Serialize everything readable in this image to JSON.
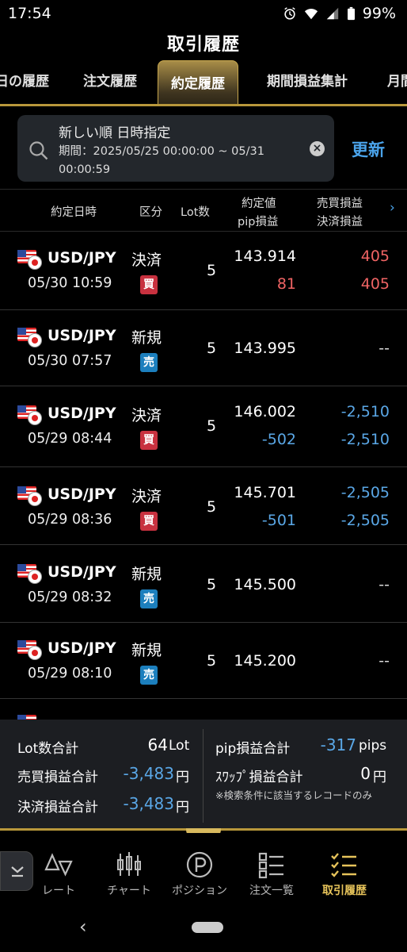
{
  "status_bar": {
    "time": "17:54",
    "battery": "99%",
    "icons": [
      "alarm-icon",
      "wifi-icon",
      "signal-icon",
      "battery-icon"
    ]
  },
  "header": {
    "title": "取引履歴"
  },
  "tabs": [
    {
      "label": "日の履歴"
    },
    {
      "label": "注文履歴"
    },
    {
      "label": "約定履歴",
      "active": true
    },
    {
      "label": "期間損益集計"
    },
    {
      "label": "月間"
    }
  ],
  "search": {
    "line1": "新しい順 日時指定",
    "line2": "期間：2025/05/25 00:00:00 ~ 05/31 00:00:59",
    "clear_icon": "×"
  },
  "refresh_label": "更新",
  "table_header": {
    "datetime": "約定日時",
    "kind": "区分",
    "lot": "Lot数",
    "price": "約定値",
    "pip": "pip損益",
    "trade_pl": "売買損益",
    "settle_pl": "決済損益",
    "more": "›"
  },
  "rows": [
    {
      "pair": "USD/JPY",
      "datetime": "05/30 10:59",
      "kind": "決済",
      "side": "買",
      "lot": "5",
      "price": "143.914",
      "pip": "81",
      "trade_pl": "405",
      "settle_pl": "405"
    },
    {
      "pair": "USD/JPY",
      "datetime": "05/30 07:57",
      "kind": "新規",
      "side": "売",
      "lot": "5",
      "price": "143.995",
      "pip": "",
      "trade_pl": "--",
      "settle_pl": ""
    },
    {
      "pair": "USD/JPY",
      "datetime": "05/29 08:44",
      "kind": "決済",
      "side": "買",
      "lot": "5",
      "price": "146.002",
      "pip": "-502",
      "trade_pl": "-2,510",
      "settle_pl": "-2,510"
    },
    {
      "pair": "USD/JPY",
      "datetime": "05/29 08:36",
      "kind": "決済",
      "side": "買",
      "lot": "5",
      "price": "145.701",
      "pip": "-501",
      "trade_pl": "-2,505",
      "settle_pl": "-2,505"
    },
    {
      "pair": "USD/JPY",
      "datetime": "05/29 08:32",
      "kind": "新規",
      "side": "売",
      "lot": "5",
      "price": "145.500",
      "pip": "",
      "trade_pl": "--",
      "settle_pl": ""
    },
    {
      "pair": "USD/JPY",
      "datetime": "05/29 08:10",
      "kind": "新規",
      "side": "売",
      "lot": "5",
      "price": "145.200",
      "pip": "",
      "trade_pl": "--",
      "settle_pl": ""
    }
  ],
  "summary": {
    "lot_label": "Lot数合計",
    "lot_value": "64",
    "lot_unit": "Lot",
    "trade_label": "売買損益合計",
    "trade_value": "-3,483",
    "trade_unit": "円",
    "settle_label": "決済損益合計",
    "settle_value": "-3,483",
    "settle_unit": "円",
    "pip_label": "pip損益合計",
    "pip_value": "-317",
    "pip_unit": "pips",
    "swap_label": "ｽﾜｯﾌﾟ損益合計",
    "swap_value": "0",
    "swap_unit": "円",
    "note": "※検索条件に該当するレコードのみ"
  },
  "bottom_nav": [
    {
      "label": "レート",
      "icon": "rate-icon"
    },
    {
      "label": "チャート",
      "icon": "chart-icon"
    },
    {
      "label": "ポジション",
      "icon": "position-icon"
    },
    {
      "label": "注文一覧",
      "icon": "order-list-icon"
    },
    {
      "label": "取引履歴",
      "icon": "history-icon",
      "active": true
    }
  ],
  "colors": {
    "accent_gold": "#b8973b",
    "profit": "#f06464",
    "loss": "#5aa7e6",
    "link": "#4aa3ea"
  }
}
